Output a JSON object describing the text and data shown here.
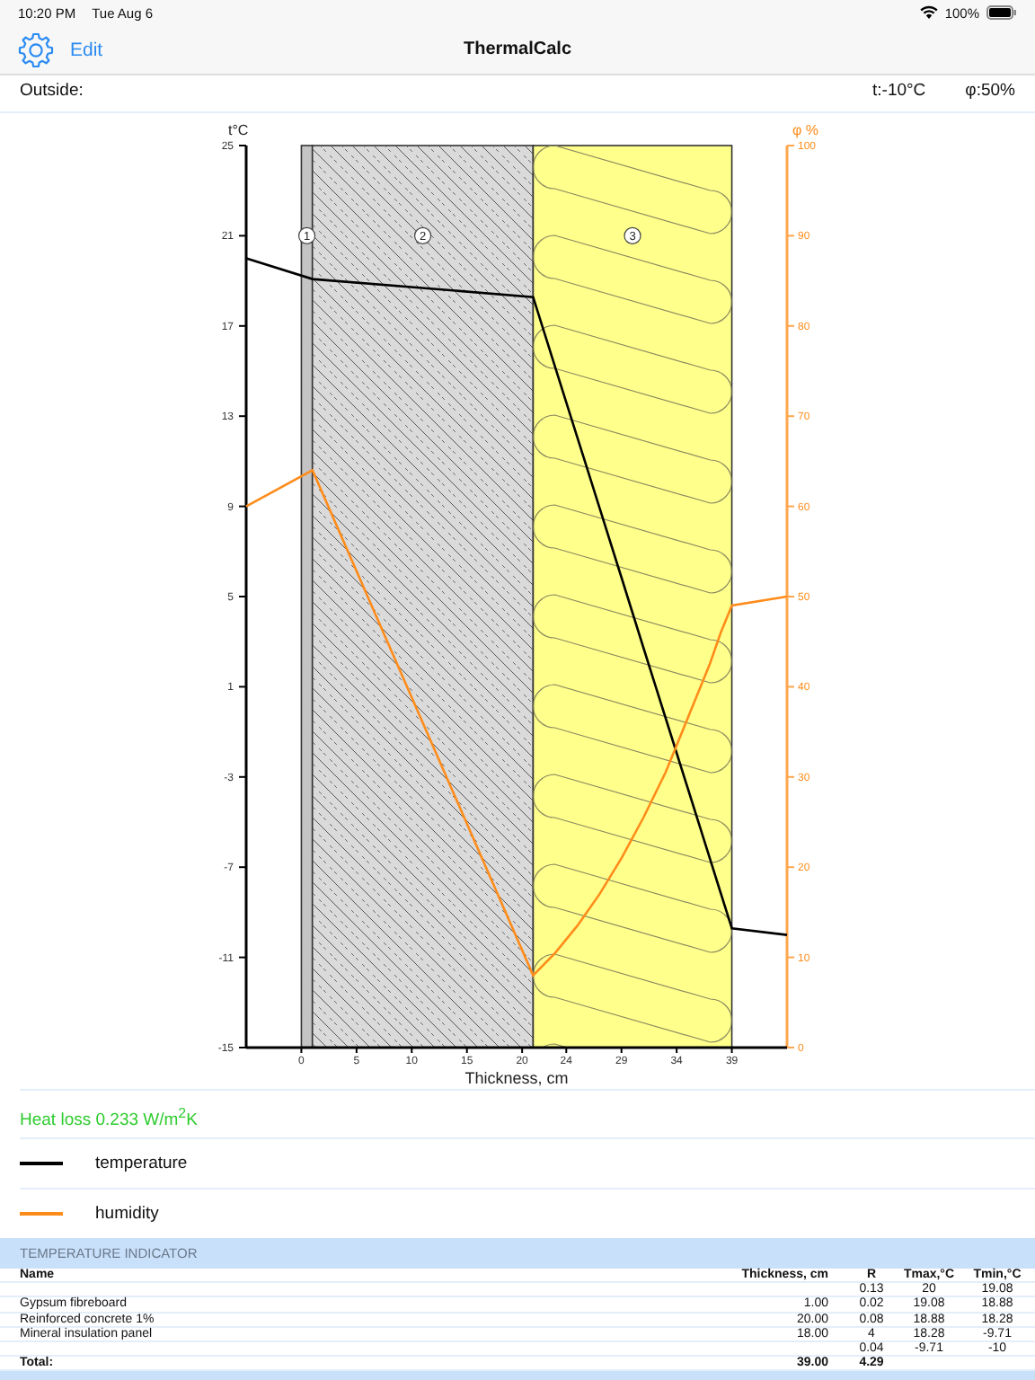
{
  "status_bar": {
    "time": "10:20 PM",
    "date": "Tue Aug 6",
    "battery": "100%"
  },
  "nav_bar": {
    "edit": "Edit",
    "title": "ThermalCalc"
  },
  "outside": {
    "label": "Outside:",
    "temperature": "t:-10°C",
    "humidity": "φ:50%"
  },
  "diagram": {
    "layers": [
      {
        "kind": "plaster"
      },
      {
        "kind": "concrete"
      },
      {
        "kind": "insulation"
      }
    ],
    "chart_data": {
      "type": "line",
      "xlabel": "Thickness, cm",
      "ylabel": "t°C",
      "y2label": "φ %",
      "xlim": [
        -5,
        44
      ],
      "ylim": [
        -15,
        25
      ],
      "y2lim": [
        0,
        100
      ],
      "xticks": [
        0,
        5,
        10,
        15,
        20,
        24,
        29,
        34,
        39
      ],
      "bands": [
        {
          "axis": "x",
          "from": 0,
          "to": 1,
          "label": "1",
          "color": "#c4c4c4"
        },
        {
          "axis": "x",
          "from": 1,
          "to": 21,
          "label": "2",
          "color": "#dadada"
        },
        {
          "axis": "x",
          "from": 21,
          "to": 39,
          "label": "3",
          "color": "#ffff8c"
        }
      ],
      "yticks": [
        25,
        21,
        17,
        13,
        9,
        5,
        1,
        -3,
        -7,
        -11,
        -15
      ],
      "y2ticks": [
        100,
        90,
        80,
        70,
        60,
        50,
        40,
        30,
        20,
        10,
        0
      ],
      "x": [
        -5,
        1,
        21,
        23,
        25,
        27,
        29,
        31,
        33,
        35,
        37,
        38,
        39,
        44
      ],
      "series": [
        {
          "name": "temperature",
          "color": "#000000",
          "values": [
            20.0,
            19.08,
            18.28,
            15.17,
            12.06,
            8.95,
            5.84,
            2.73,
            -0.38,
            -3.49,
            -6.6,
            -8.15,
            -9.71,
            -10
          ]
        },
        {
          "name": "humidity",
          "color": "#ff8c1a",
          "axis": "y2",
          "values": [
            60,
            64,
            8,
            10.5,
            13.5,
            17,
            21,
            25.5,
            30.5,
            36.5,
            42.5,
            46,
            49,
            50
          ]
        }
      ]
    }
  },
  "heat_loss": "Heat loss 0.233 W/m$^{2}$K",
  "table": {
    "title": "TEMPERATURE INDICATOR",
    "columns": [
      "Name",
      "Thickness, cm",
      "R",
      "Tmax,°C",
      "Tmin,°C"
    ],
    "rows": [
      {
        "r": "0.13",
        "tmax": "20",
        "tmin": "19.08"
      },
      {
        "name": "Gypsum fibreboard",
        "thickness": "1.00",
        "r": "0.02",
        "tmax": "19.08",
        "tmin": "18.88"
      },
      {
        "name": "Reinforced concrete 1%",
        "thickness": "20.00",
        "r": "0.08",
        "tmax": "18.88",
        "tmin": "18.28"
      },
      {
        "name": "Mineral insulation panel",
        "thickness": "18.00",
        "r": "4",
        "tmax": "18.28",
        "tmin": "-9.71"
      },
      {
        "r": "0.04",
        "tmax": "-9.71",
        "tmin": "-10"
      }
    ],
    "total": {
      "name": "Total:",
      "thickness": "39.00",
      "r": "4.29"
    }
  }
}
